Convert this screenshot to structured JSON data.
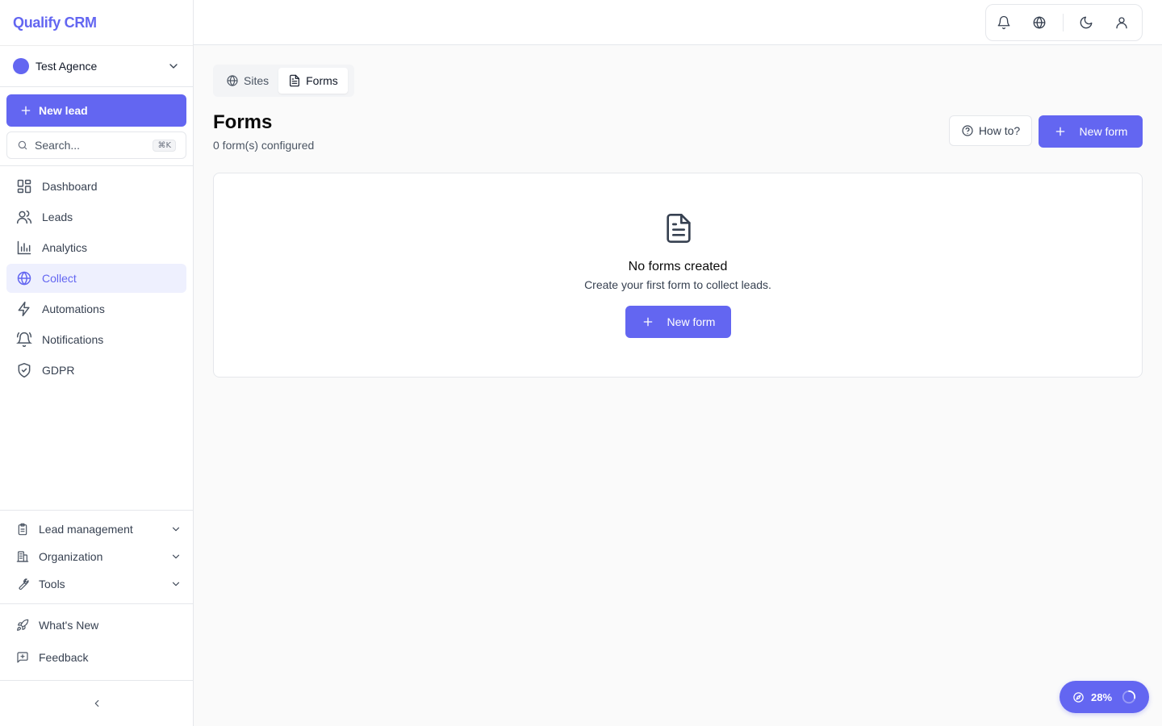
{
  "app": {
    "name": "Qualify CRM"
  },
  "org": {
    "name": "Test Agence"
  },
  "sidebar": {
    "new_lead_label": "New lead",
    "search_placeholder": "Search...",
    "search_shortcut": "⌘K",
    "nav": [
      {
        "label": "Dashboard",
        "icon": "dashboard-icon"
      },
      {
        "label": "Leads",
        "icon": "users-icon"
      },
      {
        "label": "Analytics",
        "icon": "bar-chart-icon"
      },
      {
        "label": "Collect",
        "icon": "globe-icon",
        "active": true
      },
      {
        "label": "Automations",
        "icon": "lightning-icon"
      },
      {
        "label": "Notifications",
        "icon": "bell-ring-icon"
      },
      {
        "label": "GDPR",
        "icon": "shield-check-icon"
      }
    ],
    "groups": [
      {
        "label": "Lead management",
        "icon": "clipboard-icon"
      },
      {
        "label": "Organization",
        "icon": "building-icon"
      },
      {
        "label": "Tools",
        "icon": "wrench-icon"
      }
    ],
    "extras": [
      {
        "label": "What's New",
        "icon": "rocket-icon"
      },
      {
        "label": "Feedback",
        "icon": "message-square-icon"
      }
    ]
  },
  "tabs": [
    {
      "label": "Sites",
      "icon": "globe-icon"
    },
    {
      "label": "Forms",
      "icon": "file-text-icon",
      "active": true
    }
  ],
  "page": {
    "title": "Forms",
    "subtitle": "0 form(s) configured",
    "howto_label": "How to?",
    "new_form_label": "New form"
  },
  "empty": {
    "title": "No forms created",
    "subtitle": "Create your first form to collect leads.",
    "button_label": "New form"
  },
  "progress": {
    "label": "28%",
    "value": 0.28
  },
  "colors": {
    "accent": "#6366f1",
    "active_bg": "#eef0fe"
  }
}
